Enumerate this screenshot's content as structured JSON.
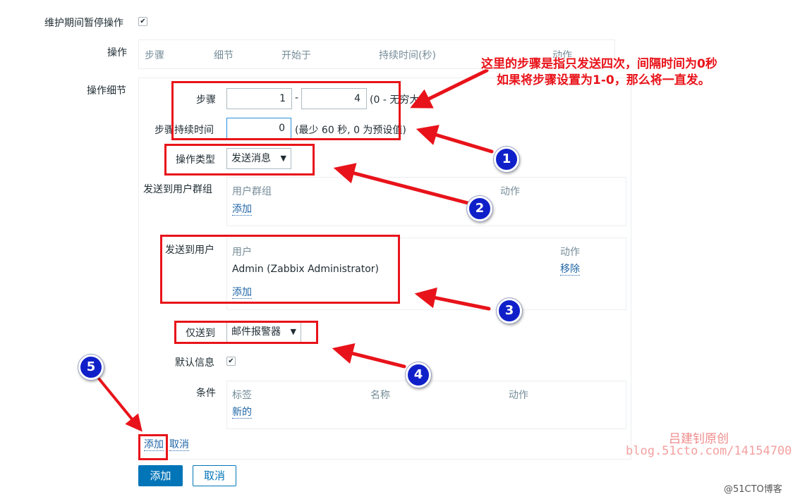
{
  "pause_maintenance": {
    "label": "维护期间暂停操作",
    "checked": true
  },
  "operations": {
    "label": "操作",
    "headers": [
      "步骤",
      "细节",
      "开始于",
      "持续时间(秒)",
      "动作"
    ]
  },
  "details": {
    "label": "操作细节",
    "steps": {
      "label": "步骤",
      "from": "1",
      "separator": "-",
      "to": "4",
      "hint": "(0 - 无穷大)"
    },
    "step_duration": {
      "label": "步骤持续时间",
      "value": "0",
      "hint": "(最少 60 秒, 0 为预设值)"
    },
    "operation_type": {
      "label": "操作类型",
      "value": "发送消息"
    },
    "send_to_groups": {
      "label": "发送到用户群组",
      "col_group": "用户群组",
      "col_action": "动作",
      "add": "添加"
    },
    "send_to_users": {
      "label": "发送到用户",
      "col_user": "用户",
      "col_action": "动作",
      "rows": [
        {
          "user": "Admin (Zabbix Administrator)",
          "action": "移除"
        }
      ],
      "add": "添加"
    },
    "send_only_to": {
      "label": "仅送到",
      "value": "邮件报警器"
    },
    "default_message": {
      "label": "默认信息",
      "checked": true
    },
    "conditions": {
      "label": "条件",
      "col_tag": "标签",
      "col_name": "名称",
      "col_action": "动作",
      "new": "新的"
    },
    "add_link": "添加",
    "cancel_link": "取消"
  },
  "buttons": {
    "add": "添加",
    "cancel": "取消"
  },
  "annotations": {
    "line1": "这里的步骤是指只发送四次，间隔时间为0秒",
    "line2": "如果将步骤设置为1-0，那么将一直发。",
    "markers": [
      "1",
      "2",
      "3",
      "4",
      "5"
    ]
  },
  "watermark": {
    "author": "吕建钊原创",
    "url": "blog.51cto.com/14154700",
    "site": "@51CTO博客"
  },
  "colors": {
    "accent": "#0275b8",
    "annotation_red": "#e8131a",
    "marker_blue": "#1020c9",
    "link": "#1f65a6"
  }
}
